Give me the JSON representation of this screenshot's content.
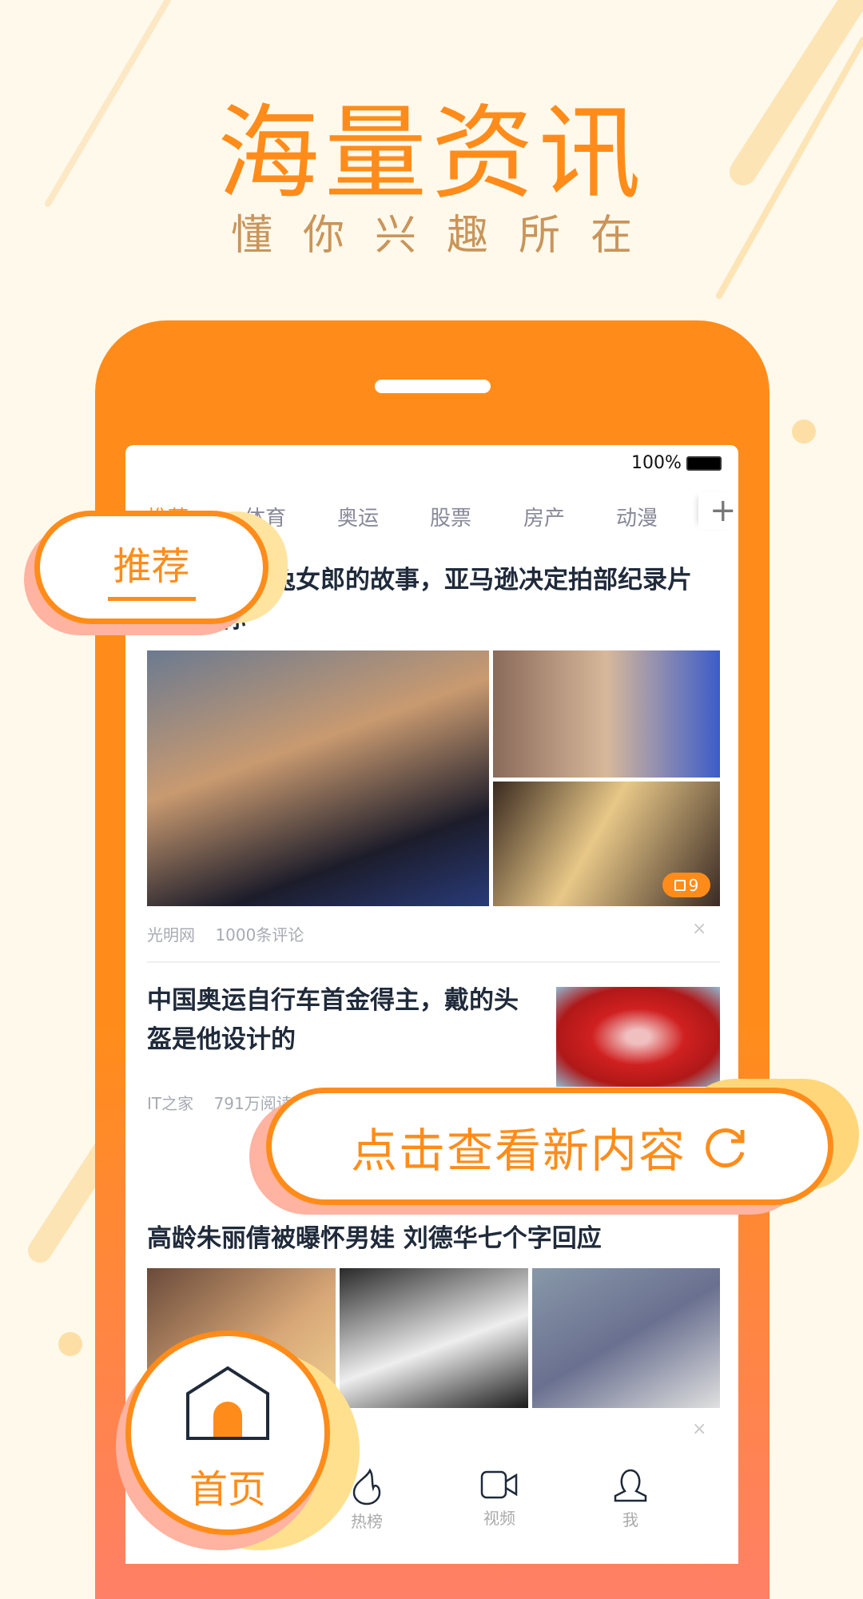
{
  "hero": {
    "title": "海量资讯",
    "subtitle": "懂你兴趣所在"
  },
  "status": {
    "battery": "100%"
  },
  "tabs": [
    {
      "label": "推荐",
      "active": true
    },
    {
      "label": "体育"
    },
    {
      "label": "奥运"
    },
    {
      "label": "股票"
    },
    {
      "label": "房产"
    },
    {
      "label": "动漫"
    }
  ],
  "add_tab": "+",
  "callout_tab": "推荐",
  "articles": [
    {
      "title": "花花公子和兔女郎的故事，亚马逊决定拍部纪录片来告诉你",
      "source": "光明网",
      "stat": "1000条评论",
      "image_count": "9"
    },
    {
      "title": "中国奥运自行车首金得主，戴的头盔是他设计的",
      "source": "IT之家",
      "stat": "791万阅读"
    },
    {
      "title": "高龄朱丽倩被曝怀男娃 刘德华七个字回应"
    }
  ],
  "close_label": "×",
  "refresh_button": "点击查看新内容",
  "bottom_nav": [
    {
      "label": "首页",
      "icon": "home-icon",
      "active": true
    },
    {
      "label": "热榜",
      "icon": "flame-icon"
    },
    {
      "label": "视频",
      "icon": "video-camera-icon"
    },
    {
      "label": "我",
      "icon": "user-icon"
    }
  ],
  "colors": {
    "accent": "#FF8C1A",
    "background": "#FFF9EC",
    "text": "#1F2A3A"
  }
}
